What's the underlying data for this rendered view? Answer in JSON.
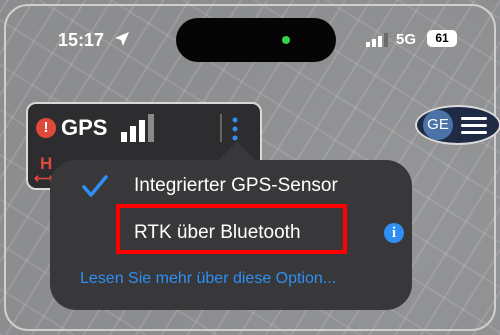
{
  "status_bar": {
    "time": "15:17",
    "network": "5G",
    "battery": "61"
  },
  "gps_panel": {
    "label": "GPS",
    "h_label": "H",
    "h_arrows": "⟷"
  },
  "popup": {
    "option_integrated": "Integrierter GPS-Sensor",
    "option_rtk": "RTK über Bluetooth",
    "more_link": "Lesen Sie mehr über diese Option..."
  },
  "ge_button": {
    "badge": "GE"
  },
  "colors": {
    "accent": "#2f8ff5",
    "alert": "#e0483b",
    "highlight": "#ff0000"
  },
  "icons": [
    "location-arrow-icon",
    "signal-icon",
    "alert-icon",
    "gps-signal-icon",
    "more-vertical-icon",
    "checkmark-icon",
    "info-icon",
    "menu-icon"
  ]
}
